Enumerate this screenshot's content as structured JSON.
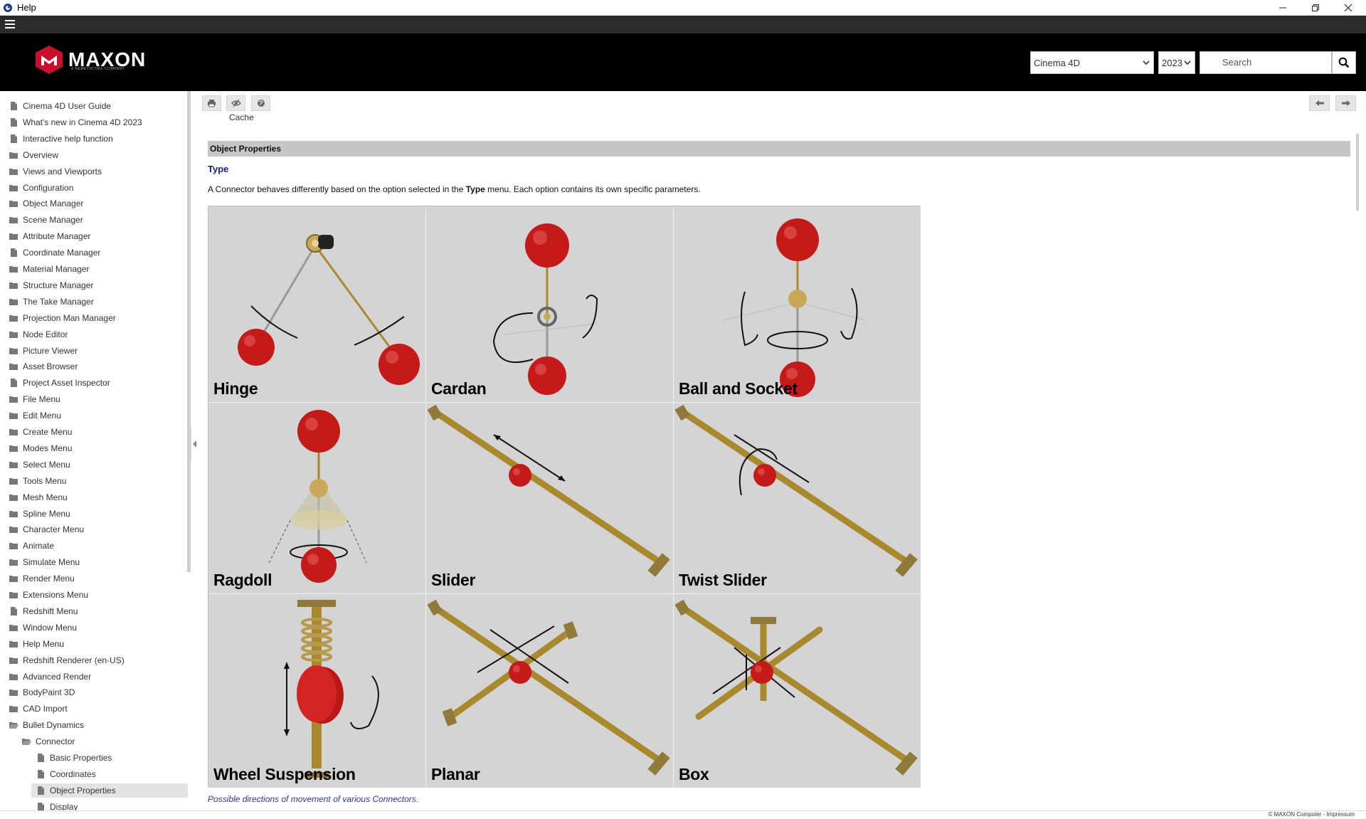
{
  "window": {
    "title": "Help"
  },
  "header": {
    "brand": "MAXON",
    "tagline": "A NEMETSCHEK COMPANY",
    "product_select": "Cinema 4D",
    "version_select": "2023",
    "search_placeholder": "Search"
  },
  "sidebar": {
    "items": [
      {
        "label": "Cinema 4D User Guide",
        "icon": "page-icon"
      },
      {
        "label": "What's new in Cinema 4D 2023",
        "icon": "page-icon"
      },
      {
        "label": "Interactive help function",
        "icon": "page-icon"
      },
      {
        "label": "Overview",
        "icon": "folder-icon"
      },
      {
        "label": "Views and Viewports",
        "icon": "folder-icon"
      },
      {
        "label": "Configuration",
        "icon": "folder-icon"
      },
      {
        "label": "Object Manager",
        "icon": "folder-icon"
      },
      {
        "label": "Scene Manager",
        "icon": "folder-icon"
      },
      {
        "label": "Attribute Manager",
        "icon": "folder-icon"
      },
      {
        "label": "Coordinate Manager",
        "icon": "page-icon"
      },
      {
        "label": "Material Manager",
        "icon": "folder-icon"
      },
      {
        "label": "Structure Manager",
        "icon": "folder-icon"
      },
      {
        "label": "The Take Manager",
        "icon": "folder-icon"
      },
      {
        "label": "Projection Man Manager",
        "icon": "folder-icon"
      },
      {
        "label": "Node Editor",
        "icon": "folder-icon"
      },
      {
        "label": "Picture Viewer",
        "icon": "folder-icon"
      },
      {
        "label": "Asset Browser",
        "icon": "folder-icon"
      },
      {
        "label": "Project Asset Inspector",
        "icon": "page-icon"
      },
      {
        "label": "File Menu",
        "icon": "folder-icon"
      },
      {
        "label": "Edit Menu",
        "icon": "folder-icon"
      },
      {
        "label": "Create Menu",
        "icon": "folder-icon"
      },
      {
        "label": "Modes Menu",
        "icon": "folder-icon"
      },
      {
        "label": "Select Menu",
        "icon": "folder-icon"
      },
      {
        "label": "Tools Menu",
        "icon": "folder-icon"
      },
      {
        "label": "Mesh Menu",
        "icon": "folder-icon"
      },
      {
        "label": "Spline Menu",
        "icon": "folder-icon"
      },
      {
        "label": "Character Menu",
        "icon": "folder-icon"
      },
      {
        "label": "Animate",
        "icon": "folder-icon"
      },
      {
        "label": "Simulate Menu",
        "icon": "folder-icon"
      },
      {
        "label": "Render Menu",
        "icon": "folder-icon"
      },
      {
        "label": "Extensions Menu",
        "icon": "folder-icon"
      },
      {
        "label": "Redshift Menu",
        "icon": "page-icon"
      },
      {
        "label": "Window Menu",
        "icon": "folder-icon"
      },
      {
        "label": "Help Menu",
        "icon": "folder-icon"
      },
      {
        "label": "Redshift Renderer (en-US)",
        "icon": "folder-icon"
      },
      {
        "label": "Advanced Render",
        "icon": "folder-icon"
      },
      {
        "label": "BodyPaint 3D",
        "icon": "folder-icon"
      },
      {
        "label": "CAD Import",
        "icon": "folder-icon"
      },
      {
        "label": "Bullet Dynamics",
        "icon": "folder-open-icon"
      },
      {
        "label": "Connector",
        "icon": "folder-open-icon"
      },
      {
        "label": "Basic Properties",
        "icon": "page-icon"
      },
      {
        "label": "Coordinates",
        "icon": "page-icon"
      },
      {
        "label": "Object Properties",
        "icon": "page-icon"
      },
      {
        "label": "Display",
        "icon": "page-icon"
      }
    ]
  },
  "content": {
    "partial_top_text": "Cache",
    "section_title": "Object Properties",
    "heading": "Type",
    "desc_before": "A Connector behaves differently based on the option selected in the ",
    "desc_bold": "Type",
    "desc_after": " menu. Each option contains its own specific parameters.",
    "connectors": [
      {
        "label": "Hinge"
      },
      {
        "label": "Cardan"
      },
      {
        "label": "Ball and Socket"
      },
      {
        "label": "Ragdoll"
      },
      {
        "label": "Slider"
      },
      {
        "label": "Twist Slider"
      },
      {
        "label": "Wheel Suspension"
      },
      {
        "label": "Planar"
      },
      {
        "label": "Box"
      }
    ],
    "caption": "Possible directions of movement of various Connectors."
  },
  "footer": {
    "text": "© MAXON Computer - Impressum"
  },
  "colors": {
    "accent_red": "#c8102e",
    "brass": "#b89a4e",
    "sphere_red": "#c41a1a"
  }
}
